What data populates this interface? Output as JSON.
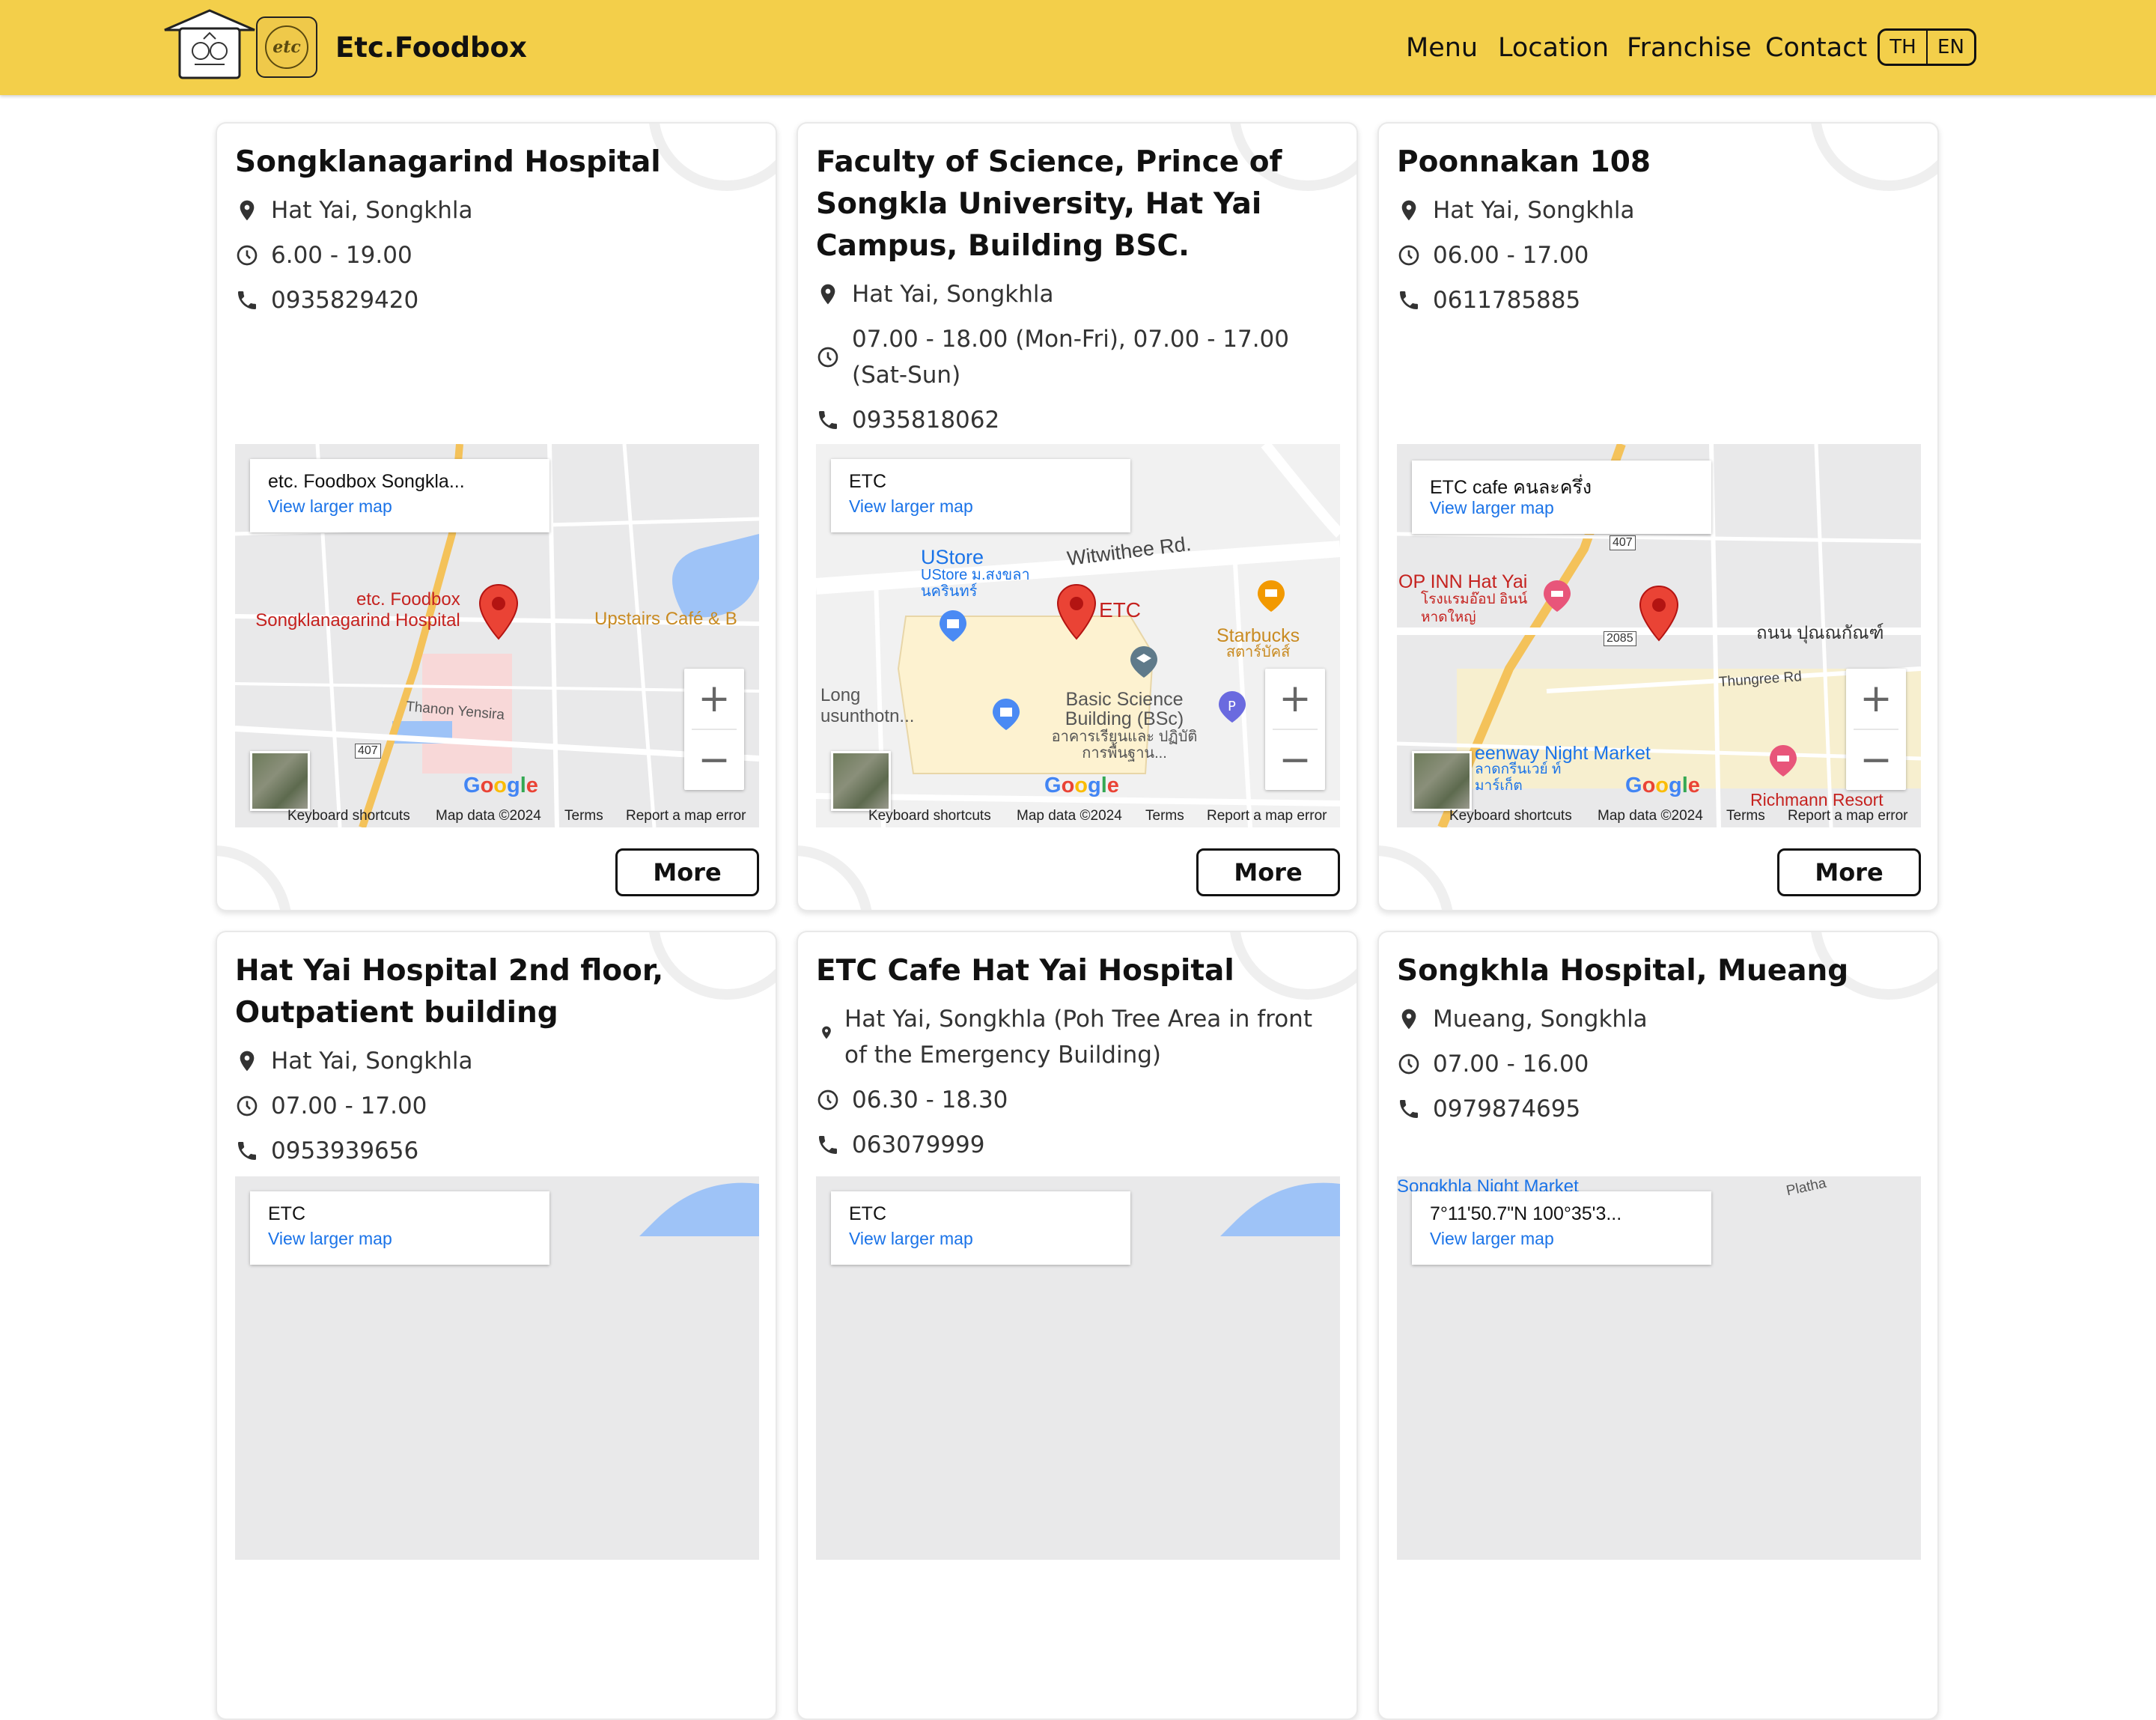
{
  "header": {
    "brand": "Etc.Foodbox",
    "nav": [
      "Menu",
      "Location",
      "Franchise",
      "Contact"
    ],
    "lang": [
      "TH",
      "EN"
    ]
  },
  "cards": [
    {
      "title": "Songklanagarind Hospital",
      "location": "Hat Yai, Songkhla",
      "hours": "6.00 - 19.00",
      "phone": "0935829420",
      "map_label": "etc. Foodbox Songkla...",
      "map_link": "View larger map",
      "map_places": [
        "etc. Foodbox",
        "Songklanagarind Hospital",
        "Upstairs Café & B",
        "Thanon Yensira",
        "407"
      ],
      "more": "More"
    },
    {
      "title": "Faculty of Science, Prince of Songkla University, Hat Yai Campus, Building BSC.",
      "location": "Hat Yai, Songkhla",
      "hours": "07.00 - 18.00 (Mon-Fri), 07.00 - 17.00 (Sat-Sun)",
      "phone": "0935818062",
      "map_label": "ETC",
      "map_link": "View larger map",
      "map_places": [
        "UStore",
        "UStore ม.สงขลา นครินทร์",
        "Witwithee Rd.",
        "ETC",
        "Starbucks",
        "สตาร์บัคส์",
        "Basic Science Building (BSc)",
        "อาคารเรียนและ ปฏิบัติการพื้นฐาน...",
        "Long usunthotn..."
      ],
      "more": "More"
    },
    {
      "title": "Poonnakan 108",
      "location": "Hat Yai, Songkhla",
      "hours": "06.00 - 17.00",
      "phone": "0611785885",
      "map_label": "ETC cafe คนละครึ่ง",
      "map_link": "View larger map",
      "map_places": [
        "OP INN Hat Yai",
        "โรงแรมอ๊อป อินน์ หาดใหญ่",
        "ถนน ปุณณกัณฑ์",
        "Thungree Rd",
        "eenway Night Market",
        "ลาดกรีนเวย์ ท์มาร์เก็ต",
        "Richmann Resort",
        "2085",
        "407"
      ],
      "more": "More"
    },
    {
      "title": "Hat Yai Hospital 2nd floor, Outpatient building",
      "location": "Hat Yai, Songkhla",
      "hours": "07.00 - 17.00",
      "phone": "0953939656",
      "map_label": "ETC",
      "map_link": "View larger map",
      "more": "More"
    },
    {
      "title": "ETC Cafe Hat Yai Hospital",
      "location": "Hat Yai, Songkhla (Poh Tree Area in front of the Emergency Building)",
      "hours": "06.30 - 18.30",
      "phone": "063079999",
      "map_label": "ETC",
      "map_link": "View larger map",
      "more": "More"
    },
    {
      "title": "Songkhla Hospital, Mueang",
      "location": "Mueang, Songkhla",
      "hours": "07.00 - 16.00",
      "phone": "0979874695",
      "map_label": "7°11'50.7\"N 100°35'3...",
      "map_link": "View larger map",
      "map_places": [
        "Songkhla Night Market",
        "Platha"
      ],
      "more": "More"
    }
  ],
  "map_common": {
    "google": "Google",
    "shortcuts": "Keyboard shortcuts",
    "map_data": "Map data ©2024",
    "terms": "Terms",
    "report": "Report a map error",
    "zoom_in": "+",
    "zoom_out": "−"
  },
  "colors": {
    "header_bg": "#f3cf4a",
    "link": "#1a73e8",
    "pin": "#d93025"
  }
}
